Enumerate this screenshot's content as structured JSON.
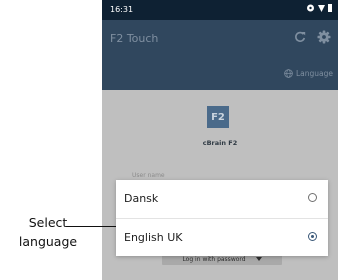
{
  "status_bar": {
    "time": "16:31"
  },
  "app_bar": {
    "title": "F2 Touch",
    "language_link": "Language"
  },
  "login": {
    "logo_text": "F2",
    "brand_name": "cBrain F2",
    "username_placeholder": "User name",
    "login_method": "Log in with password"
  },
  "language_dialog": {
    "options": [
      {
        "label": "Dansk",
        "selected": false
      },
      {
        "label": "English UK",
        "selected": true
      }
    ]
  },
  "annotation": {
    "line1": "Select",
    "line2": "language"
  },
  "colors": {
    "status_bar": "#0e2133",
    "app_bar": "#30475e",
    "scrim": "#bfbfbf",
    "accent": "#3a5878"
  },
  "icons": [
    "wifi-icon",
    "signal-icon",
    "battery-icon",
    "refresh-icon",
    "settings-icon",
    "globe-icon",
    "dropdown-arrow-icon"
  ]
}
